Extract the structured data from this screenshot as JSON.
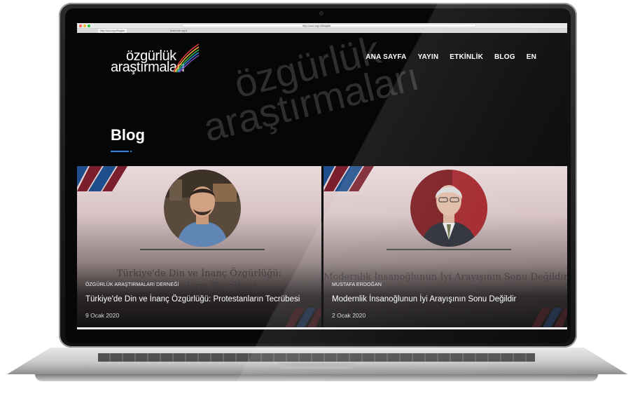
{
  "browser": {
    "url": "http://ozd.org.tr/bloglar",
    "tabs": [
      "http://ozd.org.tr/bloglar",
      "ilovecode.org.tr"
    ]
  },
  "site": {
    "logo_line1": "özgürlük",
    "logo_line2": "araştırmaları",
    "watermark_line1": "özgürlük",
    "watermark_line2": "araştırmaları",
    "nav": [
      "ANA SAYFA",
      "YAYIN",
      "ETKİNLİK",
      "BLOG",
      "EN"
    ],
    "page_title": "Blog",
    "accent_color": "#2b87e0"
  },
  "cards": [
    {
      "ghost_title_line1": "Türkiye'de Din ve İnanç Özgürlüğü:",
      "ghost_title_line2": "Protestanların Tecrübesi",
      "author": "ÖZGÜRLÜK ARAŞTIRMALARI DERNEĞİ",
      "title": "Türkiye'de Din ve İnanç Özgürlüğü: Protestanların Tecrübesi",
      "date": "9 Ocak 2020",
      "avatar_icon": "man-portrait-icon"
    },
    {
      "ghost_title_line1": "Modernlik İnsanoğlunun İyi Arayışının Sonu Değildir",
      "ghost_title_line2": "",
      "author": "MUSTAFA ERDOĞAN",
      "title": "Modernlik İnsanoğlunun İyi Arayışının Sonu Değildir",
      "date": "2 Ocak 2020",
      "avatar_icon": "man-portrait-icon"
    }
  ]
}
